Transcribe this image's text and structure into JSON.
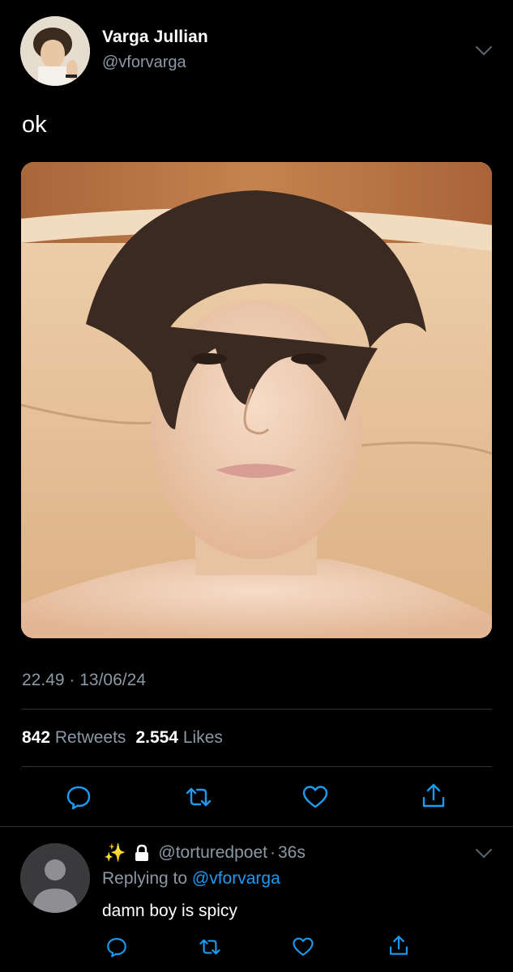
{
  "tweet": {
    "author_name": "Varga Jullian",
    "author_handle": "@vforvarga",
    "text": "ok",
    "timestamp": "22.49 · 13/06/24",
    "retweets_count": "842",
    "retweets_label": "Retweets",
    "likes_count": "2.554",
    "likes_label": "Likes"
  },
  "reply": {
    "emoji": "✨",
    "handle": "@torturedpoet",
    "separator": "·",
    "time": "36s",
    "replying_prefix": "Replying to",
    "replying_to": "@vforvarga",
    "text": "damn boy is spicy"
  },
  "icons": {
    "reply": "speech-bubble-icon",
    "retweet": "retweet-icon",
    "like": "heart-icon",
    "share": "share-icon",
    "more": "chevron-down-icon",
    "lock": "lock-icon"
  },
  "colors": {
    "background": "#000000",
    "secondary_text": "#8b98a5",
    "link": "#1d9bf0",
    "divider": "#2f3336"
  }
}
